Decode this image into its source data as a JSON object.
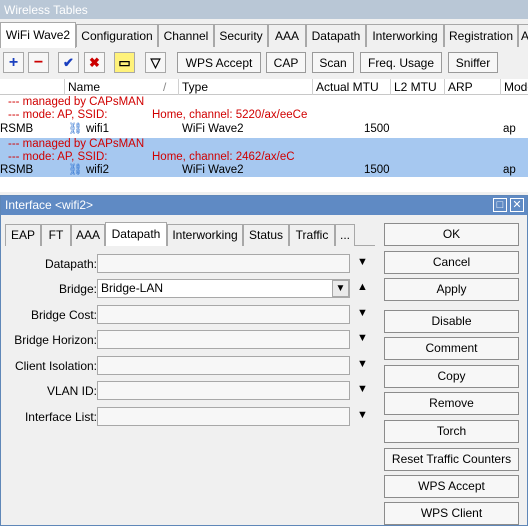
{
  "window": {
    "title": "Wireless Tables"
  },
  "tabs": [
    "WiFi Wave2",
    "Configuration",
    "Channel",
    "Security",
    "AAA",
    "Datapath",
    "Interworking",
    "Registration",
    "A"
  ],
  "toolbar": {
    "add": "+",
    "remove": "−",
    "enable": "✔",
    "disable": "✖",
    "comment": "▭",
    "filter": "▽",
    "buttons": [
      "WPS Accept",
      "CAP",
      "Scan",
      "Freq. Usage",
      "Sniffer"
    ]
  },
  "table": {
    "columns": [
      "Name",
      "/",
      "Type",
      "Actual MTU",
      "L2 MTU",
      "ARP",
      "Mode"
    ],
    "rows": [
      {
        "note": "--- managed by CAPsMAN"
      },
      {
        "note": "--- mode: AP, SSID:",
        "note2": "Home, channel: 5220/ax/eeCe"
      },
      {
        "flag": "RSMB",
        "name": "wifi1",
        "type": "WiFi Wave2",
        "mtu": "1500",
        "mode": "ap"
      },
      {
        "note": "--- managed by CAPsMAN"
      },
      {
        "note": "--- mode: AP, SSID:",
        "note2": "Home, channel: 2462/ax/eC"
      },
      {
        "flag": "RSMB",
        "name": "wifi2",
        "type": "WiFi Wave2",
        "mtu": "1500",
        "mode": "ap"
      }
    ]
  },
  "dialog": {
    "title": "Interface <wifi2>",
    "tabs": [
      "EAP",
      "FT",
      "AAA",
      "Datapath",
      "Interworking",
      "Status",
      "Traffic",
      "..."
    ],
    "fields": [
      {
        "label": "Datapath:",
        "value": ""
      },
      {
        "label": "Bridge:",
        "value": "Bridge-LAN"
      },
      {
        "label": "Bridge Cost:",
        "value": ""
      },
      {
        "label": "Bridge Horizon:",
        "value": ""
      },
      {
        "label": "Client Isolation:",
        "value": ""
      },
      {
        "label": "VLAN ID:",
        "value": ""
      },
      {
        "label": "Interface List:",
        "value": ""
      }
    ],
    "buttons": [
      "OK",
      "Cancel",
      "Apply",
      "Disable",
      "Comment",
      "Copy",
      "Remove",
      "Torch",
      "Reset Traffic Counters",
      "WPS Accept",
      "WPS Client"
    ],
    "win_buttons": {
      "max": "□",
      "close": "✕"
    }
  },
  "colors": {
    "accent": "#5f8ac4",
    "selection": "#a6c8f0",
    "note": "#d00000"
  }
}
